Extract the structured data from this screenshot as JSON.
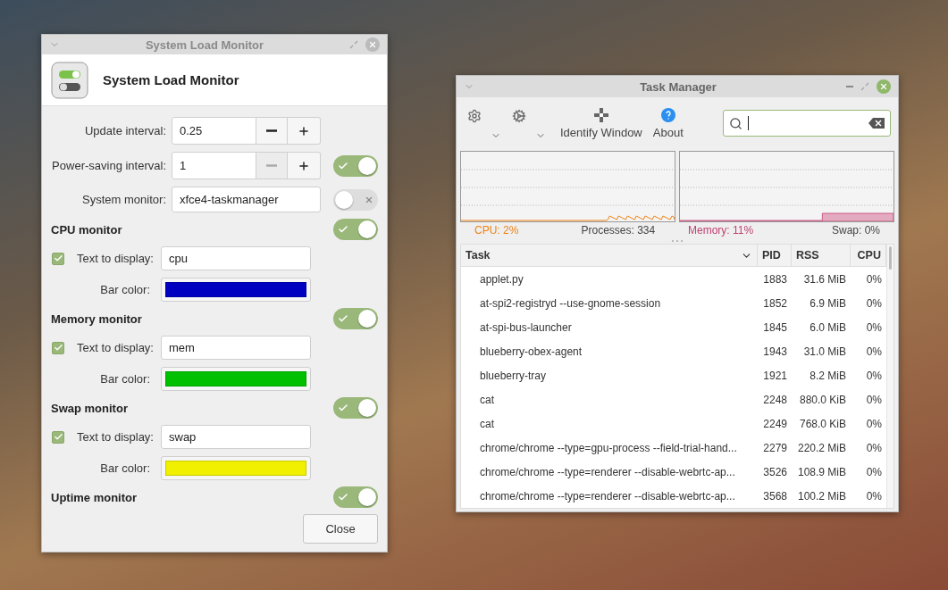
{
  "settings_window": {
    "title": "System Load Monitor",
    "heading": "System Load Monitor",
    "general": [
      {
        "kind": "spin",
        "label": "Update interval:",
        "value": "0.25",
        "minus_disabled": false
      },
      {
        "kind": "spin",
        "label": "Power-saving interval:",
        "value": "1",
        "minus_disabled": true,
        "switch_on": true
      },
      {
        "kind": "text",
        "label": "System monitor:",
        "value": "xfce4-taskmanager",
        "switch_on": false
      }
    ],
    "monitors": [
      {
        "title": "CPU monitor",
        "on": true,
        "text_checked": true,
        "text_label": "Text to display:",
        "text_value": "cpu",
        "color_label": "Bar color:",
        "color": "#0000c0"
      },
      {
        "title": "Memory monitor",
        "on": true,
        "text_checked": true,
        "text_label": "Text to display:",
        "text_value": "mem",
        "color_label": "Bar color:",
        "color": "#00c000"
      },
      {
        "title": "Swap monitor",
        "on": true,
        "text_checked": true,
        "text_label": "Text to display:",
        "text_value": "swap",
        "color_label": "Bar color:",
        "color": "#f0f000"
      },
      {
        "title": "Uptime monitor",
        "on": true
      }
    ],
    "close_button": "Close"
  },
  "task_manager": {
    "title": "Task Manager",
    "toolbar": [
      {
        "label": "Identify Window",
        "kind": "identify"
      },
      {
        "label": "About",
        "kind": "about"
      }
    ],
    "stats": {
      "cpu": "CPU: 2%",
      "processes": "Processes: 334",
      "memory": "Memory: 11%",
      "swap": "Swap: 0%"
    },
    "table": {
      "columns": [
        "Task",
        "PID",
        "RSS",
        "CPU"
      ],
      "rows": [
        [
          "applet.py",
          "1883",
          "31.6 MiB",
          "0%"
        ],
        [
          "at-spi2-registryd --use-gnome-session",
          "1852",
          "6.9 MiB",
          "0%"
        ],
        [
          "at-spi-bus-launcher",
          "1845",
          "6.0 MiB",
          "0%"
        ],
        [
          "blueberry-obex-agent",
          "1943",
          "31.0 MiB",
          "0%"
        ],
        [
          "blueberry-tray",
          "1921",
          "8.2 MiB",
          "0%"
        ],
        [
          "cat",
          "2248",
          "880.0 KiB",
          "0%"
        ],
        [
          "cat",
          "2249",
          "768.0 KiB",
          "0%"
        ],
        [
          "chrome/chrome --type=gpu-process --field-trial-hand...",
          "2279",
          "220.2 MiB",
          "0%"
        ],
        [
          "chrome/chrome --type=renderer --disable-webrtc-ap...",
          "3526",
          "108.9 MiB",
          "0%"
        ],
        [
          "chrome/chrome --type=renderer --disable-webrtc-ap...",
          "3568",
          "100.2 MiB",
          "0%"
        ]
      ]
    }
  }
}
